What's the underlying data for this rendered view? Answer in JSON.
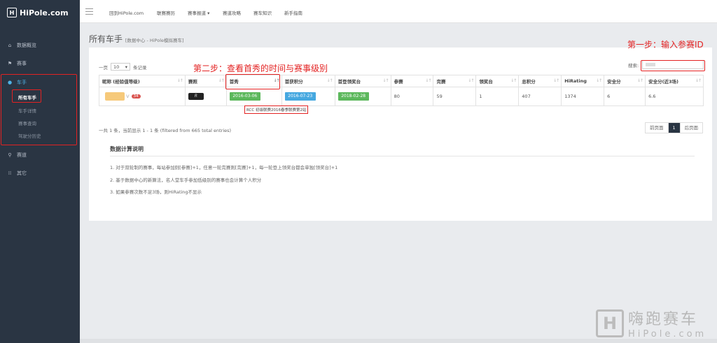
{
  "brand": {
    "icon": "H",
    "name": "HiPole.com"
  },
  "sidebar": {
    "items": [
      {
        "label": "数据概览",
        "icon": "home-icon"
      },
      {
        "label": "赛事",
        "icon": "flag-icon"
      },
      {
        "label": "车手",
        "icon": "user-icon"
      },
      {
        "label": "赛道",
        "icon": "map-marker-icon"
      },
      {
        "label": "其它",
        "icon": "grid-icon"
      }
    ],
    "subitems": [
      "所有车手",
      "车手详情",
      "赛事查询",
      "驾驶分历史"
    ]
  },
  "topnav": [
    "回到HiPole.com",
    "联赛赛历",
    "赛事报道 ▾",
    "赛道攻略",
    "赛车知识",
    "新手指南"
  ],
  "page": {
    "title": "所有车手",
    "subtitle": "[数据中心 - HiPole模拟赛车]"
  },
  "table_controls": {
    "show_prefix": "一页",
    "page_size": "10",
    "show_suffix": "条记录",
    "search_label": "搜索:"
  },
  "table": {
    "headers": [
      "昵称 (经验值等级)",
      "赛照",
      "首秀",
      "首获积分",
      "首登领奖台",
      "参赛",
      "完赛",
      "领奖台",
      "总积分",
      "HiRating",
      "安全分",
      "安全分(近3场)"
    ],
    "row": {
      "name_suffix": "V",
      "level": "34",
      "car": "R",
      "debut": "2016-03-06",
      "first_points": "2016-07-23",
      "first_podium": "2018-02-28",
      "starts": "80",
      "finishes": "59",
      "podiums": "1",
      "total_points": "407",
      "hirating": "1374",
      "safety": "6",
      "safety_recent": "6.6"
    }
  },
  "tooltip": "RCC 初级联赛2016春季联赛第2站",
  "info": "一共 1 条，当前显示 1 - 1 条 (filtered from 665 total entries)",
  "pager": {
    "prev": "前页面",
    "current": "1",
    "next": "后页面"
  },
  "calc": {
    "title": "数据计算说明",
    "items": [
      "1. 对于双轮制的赛事，每站参加则[参赛]+1，任意一轮完赛则[完赛]+1，每一轮登上领奖台都会单独[领奖台]+1",
      "2. 基于数据中心的新算法，名人堂车手参加低级别的赛事也会计算个人积分",
      "3. 如果参赛次数不足3场，则HiRating不显示"
    ]
  },
  "annotations": {
    "step1": "第一步：输入参赛ID",
    "step2": "第二步：查看首秀的时间与赛事级别"
  },
  "watermark": {
    "cn": "嗨跑赛车",
    "en": "HiPole.com",
    "icon": "H"
  },
  "colors": {
    "sidebar": "#2a3543",
    "annotation": "#e32222",
    "green": "#5cb85c",
    "blue": "#46a8e0",
    "badge": "#d9534f"
  }
}
